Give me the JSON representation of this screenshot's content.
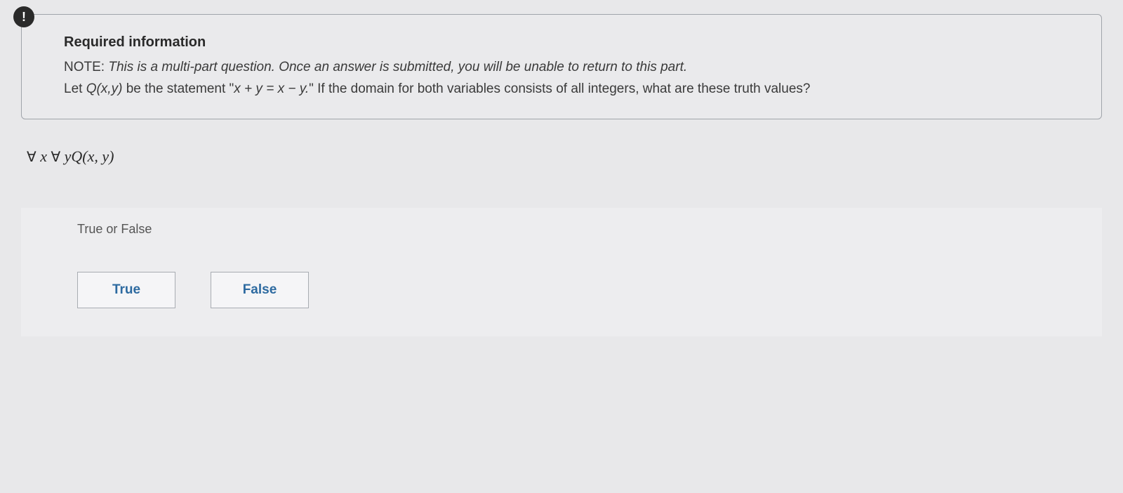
{
  "info": {
    "icon_glyph": "!",
    "heading": "Required information",
    "note_label": "NOTE: ",
    "note_text": "This is a multi-part question. Once an answer is submitted, you will be unable to return to this part.",
    "body_prefix": "Let ",
    "body_qxy": "Q(x,y)",
    "body_mid1": " be the statement \"",
    "body_eq": "x + y = x − y.",
    "body_suffix": "\" If the domain for both variables consists of all integers, what are these truth values?"
  },
  "question": {
    "forall1": "∀",
    "x": " x ",
    "forall2": "∀",
    "y": " y",
    "qxy": "Q(x, y)"
  },
  "answer": {
    "label": "True or False",
    "true_label": "True",
    "false_label": "False"
  }
}
